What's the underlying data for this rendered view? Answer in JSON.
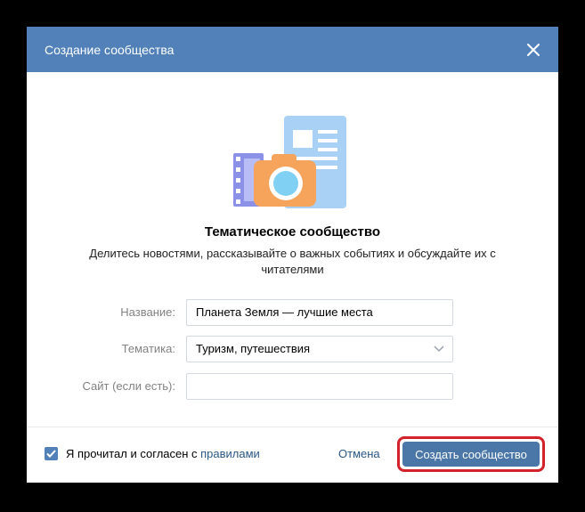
{
  "header": {
    "title": "Создание сообщества"
  },
  "content": {
    "title": "Тематическое сообщество",
    "description": "Делитесь новостями, рассказывайте о важных событиях и обсуждайте их с читателями"
  },
  "form": {
    "name_label": "Название:",
    "name_value": "Планета Земля — лучшие места",
    "topic_label": "Тематика:",
    "topic_value": "Туризм, путешествия",
    "site_label": "Сайт (если есть):",
    "site_value": ""
  },
  "footer": {
    "agree_text": "Я прочитал и согласен с ",
    "rules_link": "правилами",
    "cancel_label": "Отмена",
    "create_label": "Создать сообщество"
  },
  "colors": {
    "accent": "#5181b8",
    "button": "#4a76a8",
    "link": "#2a5885",
    "highlight": "#d3222a"
  },
  "icons": [
    "close-icon",
    "community-illustration",
    "chevron-down-icon",
    "checkmark-icon"
  ]
}
